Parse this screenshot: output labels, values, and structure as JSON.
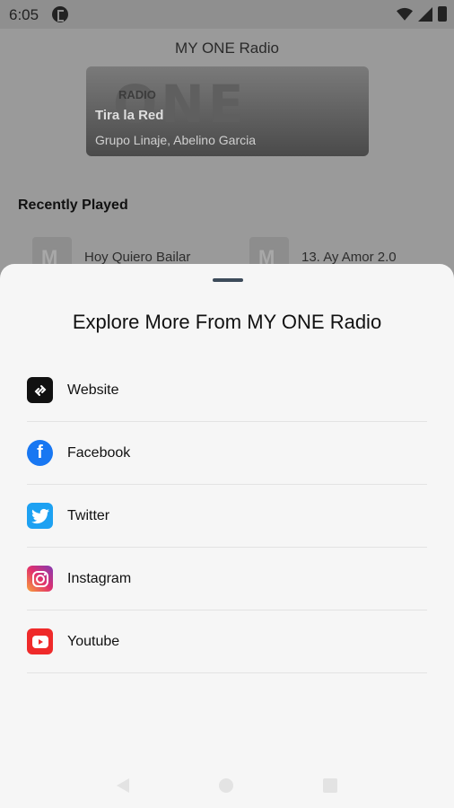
{
  "status_bar": {
    "time": "6:05"
  },
  "app": {
    "title": "MY ONE Radio",
    "player": {
      "logo_small": "RADIO",
      "logo_big": "ONE",
      "song": "Tira la Red",
      "artist": "Grupo Linaje, Abelino Garcia"
    },
    "recently_played_title": "Recently Played",
    "recent": [
      {
        "label": "Hoy Quiero Bailar"
      },
      {
        "label": "13. Ay Amor 2.0"
      }
    ]
  },
  "sheet": {
    "title": "Explore More From MY ONE Radio",
    "items": [
      {
        "label": "Website",
        "icon": "link-icon"
      },
      {
        "label": "Facebook",
        "icon": "facebook-icon"
      },
      {
        "label": "Twitter",
        "icon": "twitter-icon"
      },
      {
        "label": "Instagram",
        "icon": "instagram-icon"
      },
      {
        "label": "Youtube",
        "icon": "youtube-icon"
      }
    ]
  },
  "colors": {
    "facebook": "#1877f2",
    "twitter": "#1da1f2",
    "youtube": "#ef2a2a",
    "website": "#111111"
  }
}
